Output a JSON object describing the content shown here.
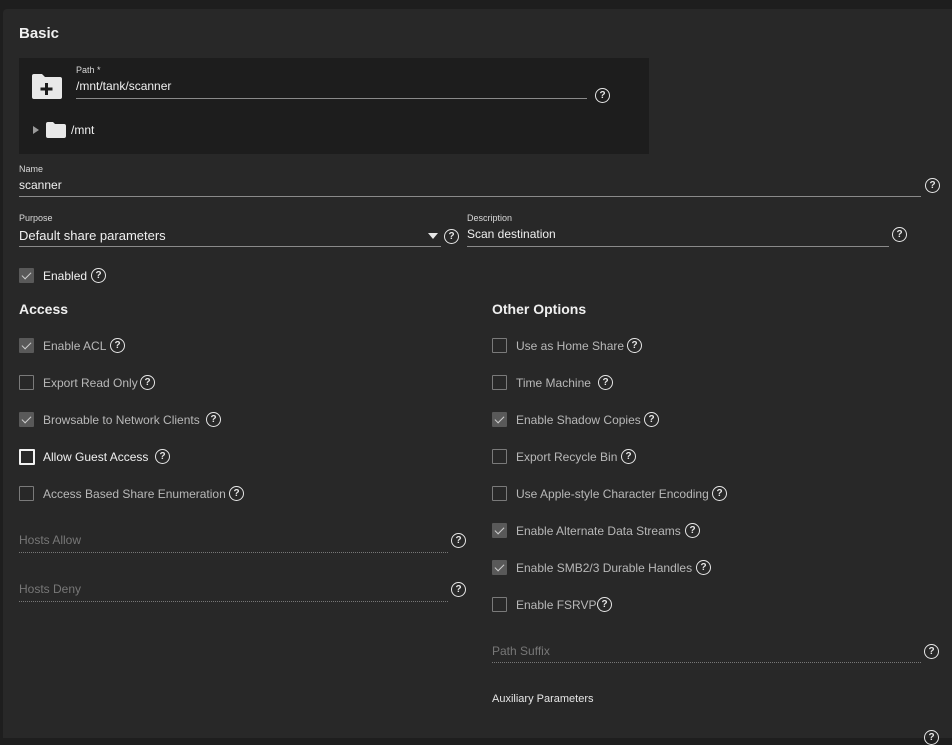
{
  "basic": {
    "title": "Basic",
    "path_label": "Path *",
    "path_value": "/mnt/tank/scanner",
    "tree_root": "/mnt",
    "name_label": "Name",
    "name_value": "scanner",
    "purpose_label": "Purpose",
    "purpose_value": "Default share parameters",
    "description_label": "Description",
    "description_value": "Scan destination",
    "enabled_label": "Enabled",
    "enabled_checked": true
  },
  "access": {
    "title": "Access",
    "options": [
      {
        "label": "Enable ACL",
        "checked": true
      },
      {
        "label": "Export Read Only",
        "checked": false
      },
      {
        "label": "Browsable to Network Clients",
        "checked": true
      },
      {
        "label": "Allow Guest Access",
        "checked": false
      },
      {
        "label": "Access Based Share Enumeration",
        "checked": false
      }
    ],
    "hosts_allow_placeholder": "Hosts Allow",
    "hosts_deny_placeholder": "Hosts Deny"
  },
  "other": {
    "title": "Other Options",
    "options": [
      {
        "label": "Use as Home Share",
        "checked": false
      },
      {
        "label": "Time Machine",
        "checked": false
      },
      {
        "label": "Enable Shadow Copies",
        "checked": true
      },
      {
        "label": "Export Recycle Bin",
        "checked": false
      },
      {
        "label": "Use Apple-style Character Encoding",
        "checked": false
      },
      {
        "label": "Enable Alternate Data Streams",
        "checked": true
      },
      {
        "label": "Enable SMB2/3 Durable Handles",
        "checked": true
      },
      {
        "label": "Enable FSRVP",
        "checked": false
      }
    ],
    "path_suffix_placeholder": "Path Suffix",
    "aux_params_label": "Auxiliary Parameters"
  },
  "icons": {
    "help": "?",
    "add_folder": "add-folder-icon",
    "folder": "folder-icon",
    "expand": "expand-arrow-icon",
    "dropdown": "dropdown-arrow-icon"
  }
}
